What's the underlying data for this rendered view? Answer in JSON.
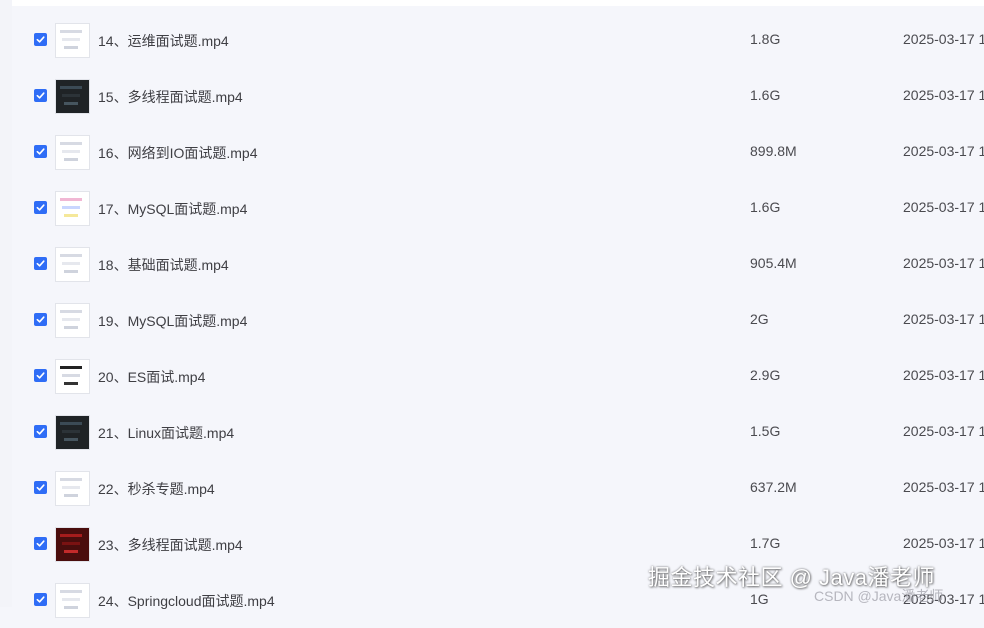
{
  "files": [
    {
      "name": "14、运维面试题.mp4",
      "size": "1.8G",
      "date": "2025-03-17 1",
      "thumb": "light",
      "checked": true
    },
    {
      "name": "15、多线程面试题.mp4",
      "size": "1.6G",
      "date": "2025-03-17 1",
      "thumb": "dark",
      "checked": true
    },
    {
      "name": "16、网络到IO面试题.mp4",
      "size": "899.8M",
      "date": "2025-03-17 1",
      "thumb": "light",
      "checked": true
    },
    {
      "name": "17、MySQL面试题.mp4",
      "size": "1.6G",
      "date": "2025-03-17 1",
      "thumb": "color",
      "checked": true
    },
    {
      "name": "18、基础面试题.mp4",
      "size": "905.4M",
      "date": "2025-03-17 1",
      "thumb": "light",
      "checked": true
    },
    {
      "name": "19、MySQL面试题.mp4",
      "size": "2G",
      "date": "2025-03-17 1",
      "thumb": "light",
      "checked": true
    },
    {
      "name": "20、ES面试.mp4",
      "size": "2.9G",
      "date": "2025-03-17 1",
      "thumb": "mixed",
      "checked": true
    },
    {
      "name": "21、Linux面试题.mp4",
      "size": "1.5G",
      "date": "2025-03-17 1",
      "thumb": "dark",
      "checked": true
    },
    {
      "name": "22、秒杀专题.mp4",
      "size": "637.2M",
      "date": "2025-03-17 1",
      "thumb": "light",
      "checked": true
    },
    {
      "name": "23、多线程面试题.mp4",
      "size": "1.7G",
      "date": "2025-03-17 1",
      "thumb": "red",
      "checked": true
    },
    {
      "name": "24、Springcloud面试题.mp4",
      "size": "1G",
      "date": "2025-03-17 1",
      "thumb": "light",
      "checked": true
    }
  ],
  "watermark": "掘金技术社区 @ Java潘老师",
  "watermark_secondary": "CSDN @Java潘老师",
  "colors": {
    "accent": "#2f6df6",
    "background": "#f5f6fb"
  }
}
